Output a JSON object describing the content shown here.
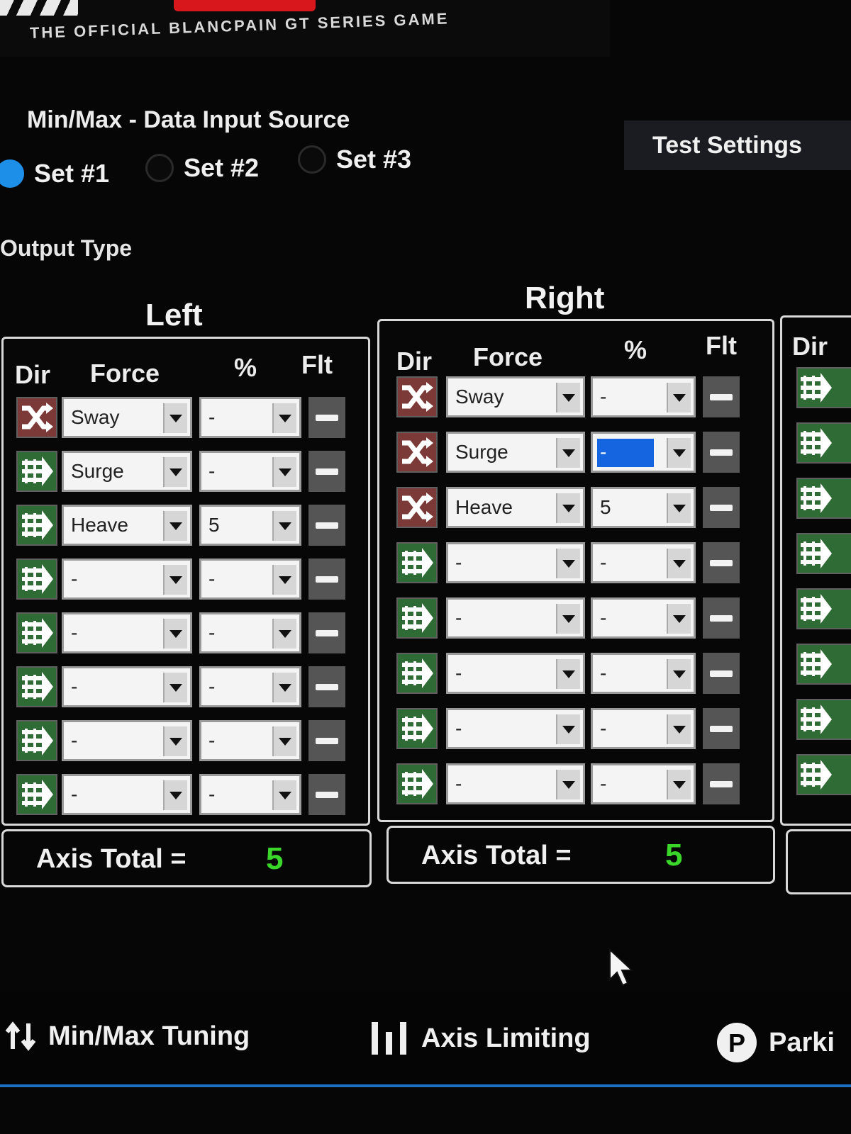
{
  "header": {
    "tagline": "THE OFFICIAL BLANCPAIN GT SERIES GAME"
  },
  "source": {
    "title": "Min/Max - Data Input Source",
    "sets": [
      {
        "label": "Set #1",
        "selected": true
      },
      {
        "label": "Set #2",
        "selected": false
      },
      {
        "label": "Set #3",
        "selected": false
      }
    ]
  },
  "test_settings_label": "Test Settings",
  "output_type_label": "Output Type",
  "columns": {
    "dir": "Dir",
    "force": "Force",
    "pct": "%",
    "flt": "Flt"
  },
  "left": {
    "title": "Left",
    "rows": [
      {
        "dir": "shuffle",
        "force": "Sway",
        "pct": "-"
      },
      {
        "dir": "arrow",
        "force": "Surge",
        "pct": "-"
      },
      {
        "dir": "arrow",
        "force": "Heave",
        "pct": "5"
      },
      {
        "dir": "arrow",
        "force": "-",
        "pct": "-"
      },
      {
        "dir": "arrow",
        "force": "-",
        "pct": "-"
      },
      {
        "dir": "arrow",
        "force": "-",
        "pct": "-"
      },
      {
        "dir": "arrow",
        "force": "-",
        "pct": "-"
      },
      {
        "dir": "arrow",
        "force": "-",
        "pct": "-"
      }
    ],
    "total_label": "Axis Total =",
    "total_value": "5"
  },
  "right": {
    "title": "Right",
    "rows": [
      {
        "dir": "shuffle",
        "force": "Sway",
        "pct": "-"
      },
      {
        "dir": "shuffle",
        "force": "Surge",
        "pct": "-"
      },
      {
        "dir": "shuffle",
        "force": "Heave",
        "pct": "5"
      },
      {
        "dir": "arrow",
        "force": "-",
        "pct": "-"
      },
      {
        "dir": "arrow",
        "force": "-",
        "pct": "-"
      },
      {
        "dir": "arrow",
        "force": "-",
        "pct": "-"
      },
      {
        "dir": "arrow",
        "force": "-",
        "pct": "-"
      },
      {
        "dir": "arrow",
        "force": "-",
        "pct": "-"
      }
    ],
    "total_label": "Axis Total =",
    "total_value": "5"
  },
  "third_panel": {
    "dir_header": "Dir"
  },
  "nav": [
    {
      "label": "Min/Max Tuning",
      "icon": "updown-arrows-icon"
    },
    {
      "label": "Axis Limiting",
      "icon": "bars-icon"
    },
    {
      "label": "Parki",
      "icon": "parking-icon"
    }
  ],
  "colors": {
    "accent_blue": "#1e8fe8",
    "total_green": "#3ad62a",
    "shuffle_bg": "#7b3a37",
    "arrow_bg": "#2f6b34"
  }
}
